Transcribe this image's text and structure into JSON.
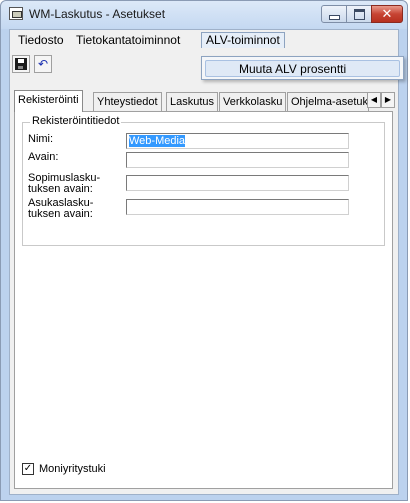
{
  "window": {
    "title": "WM-Laskutus - Asetukset",
    "minimize_glyph": "",
    "maximize_glyph": "",
    "close_glyph": "✕"
  },
  "menu": {
    "items": [
      "Tiedosto",
      "Tietokantatoiminnot",
      "ALV-toiminnot"
    ],
    "open_index": 2,
    "dropdown": [
      "Muuta ALV prosentti"
    ]
  },
  "toolbar": {
    "icons": [
      "save-icon",
      "undo-icon"
    ],
    "undo_glyph": "↶"
  },
  "tabs": {
    "labels": [
      "Rekisteröinti",
      "Yhteystiedot",
      "Laskutus",
      "Verkkolasku",
      "Ohjelma-asetuk"
    ],
    "active_index": 0,
    "scroll_left": "◀",
    "scroll_right": "▶"
  },
  "registration": {
    "group_title": "Rekisteröintitiedot",
    "name_label": "Nimi:",
    "name_value": "Web-Media",
    "key_label": "Avain:",
    "key_value": "",
    "contract_key_label_1": "Sopimuslasku-",
    "contract_key_label_2": "tuksen avain:",
    "contract_key_value": "",
    "customer_key_label_1": "Asukaslasku-",
    "customer_key_label_2": "tuksen avain:",
    "customer_key_value": ""
  },
  "footer": {
    "multicompany_label": "Moniyritystuki",
    "multicompany_checked": true,
    "check_glyph": "✓"
  }
}
